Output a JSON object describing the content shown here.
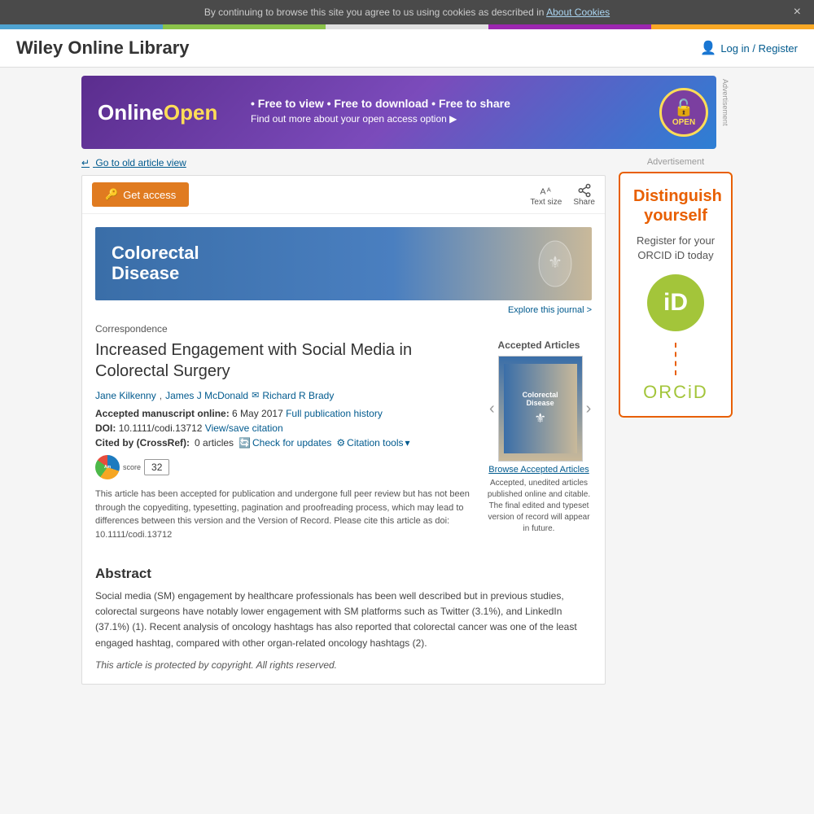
{
  "cookie_banner": {
    "text": "By continuing to browse this site you agree to us using cookies as described in",
    "link_text": "About Cookies",
    "close_label": "×"
  },
  "header": {
    "logo": "Wiley Online Library",
    "login_text": "Log in / Register"
  },
  "ad_banner": {
    "brand": "OnlineOpen",
    "tagline": "• Free to view • Free to download • Free to share",
    "cta": "Find out more about your open access option ▶",
    "open_label": "OPEN",
    "side_label": "Advertisement"
  },
  "old_article": {
    "link_text": "Go to old article view"
  },
  "toolbar": {
    "get_access": "Get access",
    "text_size": "Text size",
    "share": "Share"
  },
  "journal": {
    "title_line1": "Colorectal",
    "title_line2": "Disease",
    "explore_link": "Explore this journal >"
  },
  "article": {
    "correspondence_label": "Correspondence",
    "title": "Increased Engagement with Social Media in Colorectal Surgery",
    "authors": [
      {
        "name": "Jane Kilkenny",
        "has_email": false
      },
      {
        "name": "James J McDonald",
        "has_email": true
      },
      {
        "name": "Richard R Brady",
        "has_email": false
      }
    ],
    "accepted_label": "Accepted manuscript online:",
    "accepted_date": "6 May 2017",
    "full_history_link": "Full publication history",
    "doi_label": "DOI:",
    "doi_value": "10.1111/codi.13712",
    "view_save_citation": "View/save citation",
    "cited_label": "Cited by (CrossRef):",
    "cited_count": "0 articles",
    "check_updates": "Check for updates",
    "citation_tools": "Citation tools",
    "altmetric_score": "32",
    "disclaimer": "This article has been accepted for publication and undergone full peer review but has not been through the copyediting, typesetting, pagination and proofreading process, which may lead to differences between this version and the Version of Record. Please cite this article as doi: 10.1111/codi.13712"
  },
  "accepted_articles_panel": {
    "label": "Accepted Articles",
    "browse_link": "Browse  Accepted Articles",
    "description": "Accepted, unedited articles published online and citable. The final edited and typeset version of record will appear in future."
  },
  "abstract": {
    "title": "Abstract",
    "text": "Social media (SM) engagement by healthcare professionals has been well described but in previous studies, colorectal surgeons have notably lower engagement with SM platforms such as Twitter (3.1%), and LinkedIn (37.1%) (1). Recent analysis of oncology hashtags has also reported that colorectal cancer was one of the least engaged hashtag, compared with other organ-related oncology hashtags (2).",
    "protected_note": "This article is protected by copyright. All rights reserved."
  },
  "side_ad": {
    "advertisement_label": "Advertisement",
    "distinguish": "Distinguish yourself",
    "register_text": "Register for your ORCID iD today",
    "id_symbol": "iD",
    "logo": "ORC",
    "logo_accent": "iD"
  }
}
